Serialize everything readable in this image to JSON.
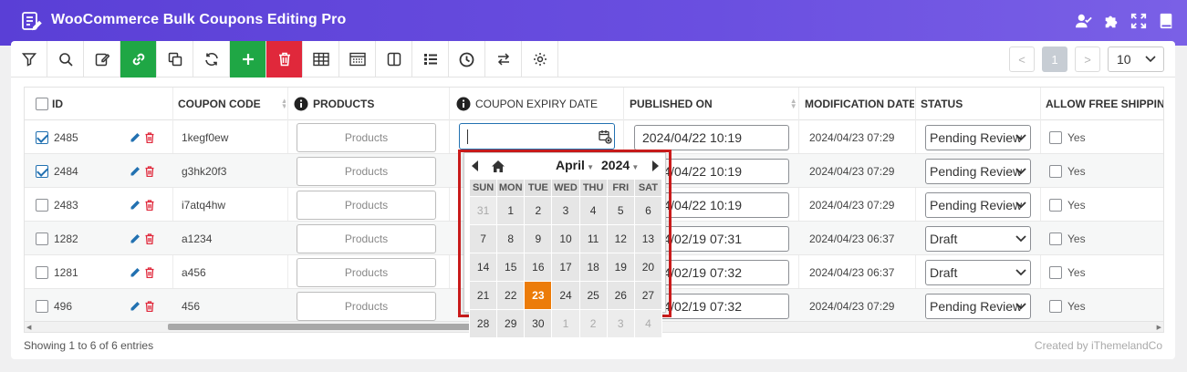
{
  "app": {
    "title": "WooCommerce Bulk Coupons Editing Pro",
    "header_icons": [
      "user-check-icon",
      "puzzle-icon",
      "expand-icon",
      "book-icon"
    ]
  },
  "toolbar": {
    "buttons": [
      "filter-icon",
      "search-icon",
      "edit-icon",
      "link-icon",
      "duplicate-icon",
      "refresh-icon",
      "add-icon",
      "delete-icon",
      "table-icon",
      "columns-icon",
      "panel-icon",
      "list-icon",
      "history-icon",
      "swap-icon",
      "settings-icon"
    ],
    "colors": {
      "green": "#1fa745",
      "red": "#e0283b"
    }
  },
  "pagination": {
    "prev": "<",
    "current": "1",
    "next": ">",
    "per_page": "10"
  },
  "table": {
    "headers": {
      "id": "ID",
      "coupon_code": "COUPON CODE",
      "products": "PRODUCTS",
      "expiry": "COUPON EXPIRY DATE",
      "published": "PUBLISHED ON",
      "modification": "MODIFICATION DATE",
      "status": "STATUS",
      "free_shipping": "ALLOW FREE SHIPPING"
    },
    "rows": [
      {
        "id": "2485",
        "checked": true,
        "code": "1kegf0ew",
        "products": "Products",
        "published": "2024/04/22 10:19",
        "modified": "2024/04/23 07:29",
        "status": "Pending Review",
        "shipping": "Yes"
      },
      {
        "id": "2484",
        "checked": true,
        "code": "g3hk20f3",
        "products": "Products",
        "published": "2024/04/22 10:19",
        "modified": "2024/04/23 07:29",
        "status": "Pending Review",
        "shipping": "Yes"
      },
      {
        "id": "2483",
        "checked": false,
        "code": "i7atq4hw",
        "products": "Products",
        "published": "2024/04/22 10:19",
        "modified": "2024/04/23 07:29",
        "status": "Pending Review",
        "shipping": "Yes"
      },
      {
        "id": "1282",
        "checked": false,
        "code": "a1234",
        "products": "Products",
        "published": "2024/02/19 07:31",
        "modified": "2024/04/23 06:37",
        "status": "Draft",
        "shipping": "Yes"
      },
      {
        "id": "1281",
        "checked": false,
        "code": "a456",
        "products": "Products",
        "published": "2024/02/19 07:32",
        "modified": "2024/04/23 06:37",
        "status": "Draft",
        "shipping": "Yes"
      },
      {
        "id": "496",
        "checked": false,
        "code": "456",
        "products": "Products",
        "published": "2024/02/19 07:32",
        "modified": "2024/04/23 07:29",
        "status": "Pending Review",
        "shipping": "Yes"
      }
    ]
  },
  "calendar": {
    "month": "April",
    "year": "2024",
    "weekdays": [
      "SUN",
      "MON",
      "TUE",
      "WED",
      "THU",
      "FRI",
      "SAT"
    ],
    "weeks": [
      [
        "31",
        "1",
        "2",
        "3",
        "4",
        "5",
        "6"
      ],
      [
        "7",
        "8",
        "9",
        "10",
        "11",
        "12",
        "13"
      ],
      [
        "14",
        "15",
        "16",
        "17",
        "18",
        "19",
        "20"
      ],
      [
        "21",
        "22",
        "23",
        "24",
        "25",
        "26",
        "27"
      ],
      [
        "28",
        "29",
        "30",
        "1",
        "2",
        "3",
        "4"
      ]
    ],
    "selected_day": "23",
    "highlight_color": "#ec7c0a"
  },
  "footer": {
    "showing": "Showing 1 to 6 of 6 entries",
    "credit": "Created by iThemelandCo"
  }
}
